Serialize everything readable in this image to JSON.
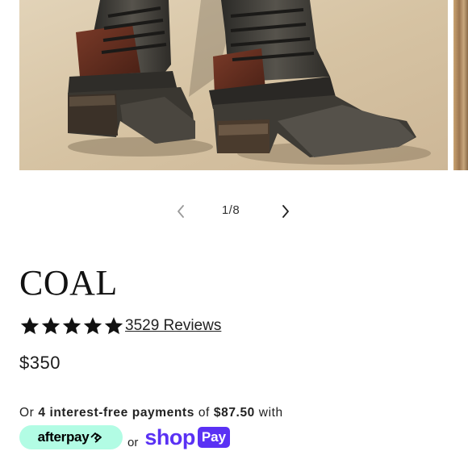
{
  "carousel": {
    "current": 1,
    "total": 8,
    "counter_label": "1/8",
    "prev_icon": "chevron-left-icon",
    "next_icon": "chevron-right-icon"
  },
  "product": {
    "title": "COAL",
    "rating": 5,
    "reviews_label": "3529 Reviews",
    "price": "$350"
  },
  "installments": {
    "prefix": "Or ",
    "count_label": "4 interest-free payments",
    "middle": " of ",
    "amount": "$87.50",
    "suffix": " with"
  },
  "payment": {
    "afterpay_label": "afterpay",
    "or_label": "or",
    "shop_label": "shop",
    "pay_label": "Pay"
  },
  "colors": {
    "afterpay_mint": "#b2fce4",
    "shop_pay_purple": "#5a31f4",
    "star": "#111111"
  }
}
